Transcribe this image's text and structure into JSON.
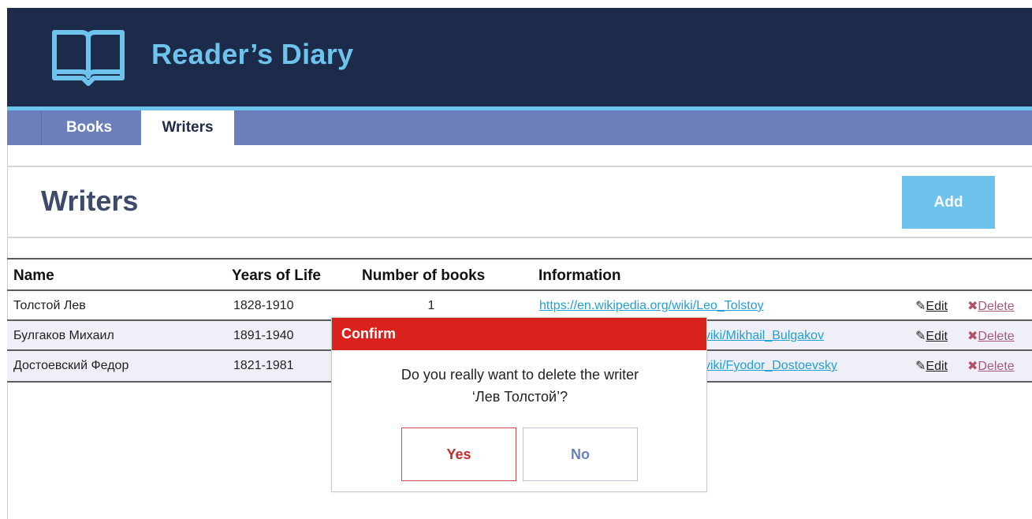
{
  "app": {
    "title": "Reader’s Diary",
    "logo_icon": "open-book-icon"
  },
  "tabs": [
    {
      "label": "Books",
      "active": false
    },
    {
      "label": "Writers",
      "active": true
    }
  ],
  "page": {
    "title": "Writers",
    "add_label": "Add"
  },
  "table": {
    "headers": [
      "Name",
      "Years of Life",
      "Number of books",
      "Information"
    ],
    "rows": [
      {
        "name": "Толстой Лев",
        "years": "1828-1910",
        "books": "1",
        "info": "https://en.wikipedia.org/wiki/Leo_Tolstoy",
        "edit": "Edit",
        "delete": "Delete"
      },
      {
        "name": "Булгаков Михаил",
        "years": "1891-1940",
        "books": "",
        "info": "viki/Mikhail_Bulgakov",
        "edit": "Edit",
        "delete": "Delete"
      },
      {
        "name": "Достоевский Федор",
        "years": "1821-1981",
        "books": "",
        "info": "viki/Fyodor_Dostoevsky",
        "edit": "Edit",
        "delete": "Delete"
      }
    ]
  },
  "dialog": {
    "title": "Confirm",
    "message_line1": "Do you really want to delete the writer",
    "message_line2": "‘Лев Толстой’?",
    "yes_label": "Yes",
    "no_label": "No"
  },
  "colors": {
    "header_bg": "#1c2b4a",
    "accent": "#6ec3ec",
    "tabbar": "#6b80bb",
    "dialog_header": "#d9221c",
    "link": "#1fa0d8"
  }
}
